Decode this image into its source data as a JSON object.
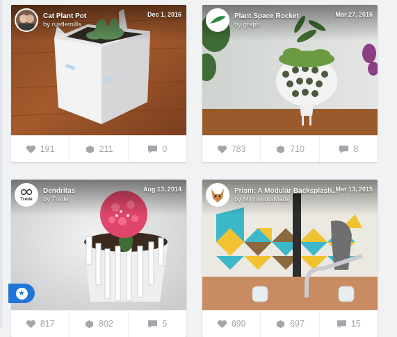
{
  "cards": [
    {
      "title": "Cat Plant Pot",
      "by": "by rustlemills",
      "date": "Dec 1, 2016",
      "likes": "191",
      "collects": "211",
      "comments": "0"
    },
    {
      "title": "Plant Space Rocket",
      "by": "by graph",
      "date": "Mar 27, 2016",
      "likes": "783",
      "collects": "710",
      "comments": "8"
    },
    {
      "title": "Dendritas",
      "by": "by Tredé",
      "date": "Aug 13, 2014",
      "likes": "817",
      "collects": "802",
      "comments": "5",
      "avatar_text": "Tredé"
    },
    {
      "title": "Prism: A Modular Backsplash...",
      "by": "by MinnesotaMade",
      "date": "Mar 13, 2015",
      "likes": "699",
      "collects": "697",
      "comments": "15"
    }
  ],
  "icons": {
    "like": "heart-icon",
    "collect": "cube-icon",
    "comment": "comment-icon",
    "fab": "star-icon"
  },
  "colors": {
    "accent": "#1f76d8",
    "stat_text": "#a3a7ac"
  }
}
